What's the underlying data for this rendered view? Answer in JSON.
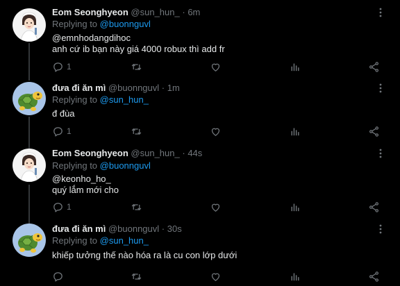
{
  "tweets": [
    {
      "name": "Eom Seonghyeon",
      "handle": "@sun_hun_",
      "dot": "·",
      "time": "6m",
      "replying_prefix": "Replying to ",
      "replying_to": "@buonnguvl",
      "mention": "@emnhodangdihoc",
      "body": "anh cứ ib bạn này giá 4000 robux thì add fr",
      "reply_count": "1",
      "avatar": "chef-girl-avatar"
    },
    {
      "name": "đưa đi ăn mì",
      "handle": "@buonnguvl",
      "dot": "·",
      "time": "1m",
      "replying_prefix": "Replying to ",
      "replying_to": "@sun_hun_",
      "mention": "",
      "body": "đ đùa",
      "reply_count": "1",
      "avatar": "turtle-avatar"
    },
    {
      "name": "Eom Seonghyeon",
      "handle": "@sun_hun_",
      "dot": "·",
      "time": "44s",
      "replying_prefix": "Replying to ",
      "replying_to": "@buonnguvl",
      "mention": "@keonho_ho_",
      "body": "quý lắm mới cho",
      "reply_count": "1",
      "avatar": "chef-girl-avatar"
    },
    {
      "name": "đưa đi ăn mì",
      "handle": "@buonnguvl",
      "dot": "·",
      "time": "30s",
      "replying_prefix": "Replying to ",
      "replying_to": "@sun_hun_",
      "mention": "",
      "body": "khiếp tưởng thế nào hóa ra là cu con lớp dưới",
      "reply_count": "",
      "avatar": "turtle-avatar"
    }
  ],
  "colors": {
    "background": "#000000",
    "text": "#e7e9ea",
    "muted": "#71767b",
    "link": "#1d9bf0",
    "divider": "#2f3336"
  },
  "icons": [
    "more-icon",
    "reply-icon",
    "retweet-icon",
    "like-icon",
    "analytics-icon",
    "share-icon"
  ]
}
